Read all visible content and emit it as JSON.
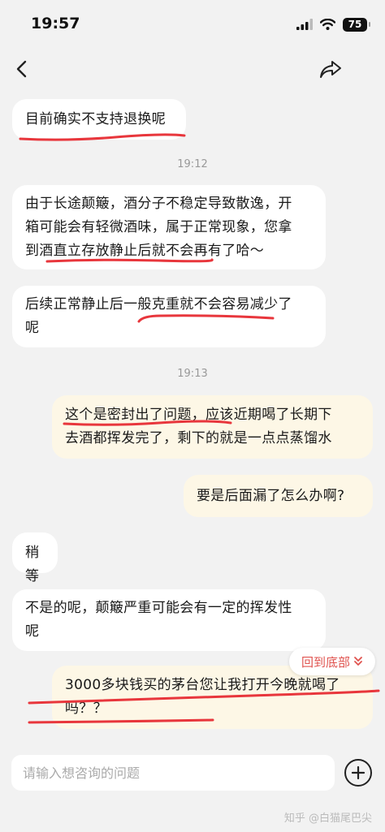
{
  "status_bar": {
    "time": "19:57",
    "battery": "75"
  },
  "messages": [
    {
      "id": "m1",
      "side": "in",
      "text": "目前确实不支持退换呢"
    },
    {
      "id": "t1",
      "type": "time",
      "text": "19:12"
    },
    {
      "id": "m2",
      "side": "in",
      "lines": [
        "由于长途颠簸，酒分子不稳定导致散逸，开",
        "箱可能会有轻微酒味，属于正常现象，您拿",
        "到酒直立存放静止后就不会再有了哈～"
      ]
    },
    {
      "id": "m3",
      "side": "in",
      "lines": [
        "后续正常静止后一般克重就不会容易减少了",
        "呢"
      ]
    },
    {
      "id": "t2",
      "type": "time",
      "text": "19:13"
    },
    {
      "id": "m4",
      "side": "out",
      "lines": [
        "这个是密封出了问题，应该近期喝了长期下",
        "去酒都挥发完了，剩下的就是一点点蒸馏水"
      ]
    },
    {
      "id": "m5",
      "side": "out",
      "text": "要是后面漏了怎么办啊?"
    },
    {
      "id": "m6",
      "side": "in",
      "text": "稍等"
    },
    {
      "id": "m7",
      "side": "in",
      "lines": [
        "不是的呢，颠簸严重可能会有一定的挥发性",
        "呢"
      ]
    },
    {
      "id": "m8",
      "side": "out",
      "lines": [
        "3000多块钱买的茅台您让我打开今晚就喝了",
        "吗？？"
      ]
    }
  ],
  "back_to_bottom": {
    "label": "回到底部",
    "icon": "double-chevron-down-icon"
  },
  "input": {
    "placeholder": "请输入想咨询的问题"
  },
  "watermark": "知乎 @白猫尾巴尖",
  "colors": {
    "annotation": "#e8363c",
    "outgoing_bubble": "#fdf7e6",
    "accent": "#e0534f"
  }
}
